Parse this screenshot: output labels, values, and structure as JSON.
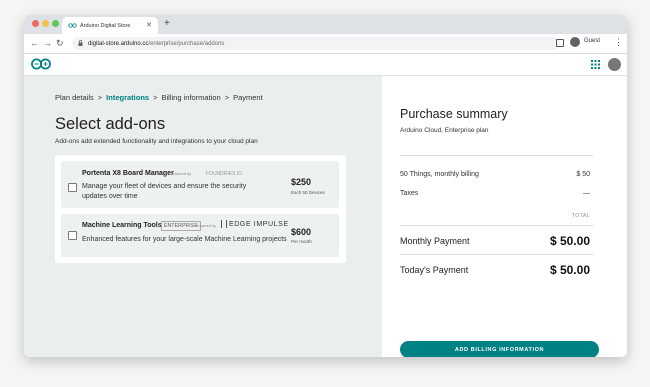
{
  "browser": {
    "tab_title": "Arduino Digital Store",
    "new_tab_label": "+",
    "url_host": "digital-store.arduino.cc",
    "url_path": "/enterprise/purchase/addons",
    "profile_label": "Guest",
    "dot_colors": [
      "#ed6a5e",
      "#f5bf4f",
      "#61c554"
    ]
  },
  "breadcrumb": {
    "items": [
      "Plan details",
      "Integrations",
      "Billing information",
      "Payment"
    ],
    "separator": ">"
  },
  "page": {
    "title": "Select add-ons",
    "subtitle": "Add-ons add extended functionality and integrations to your cloud plan"
  },
  "addons": [
    {
      "name": "Portenta X8 Board Manager",
      "powered_by": "Powered by",
      "brand": "FOUNDRIES.IO",
      "description": "Manage your fleet of devices and ensure the security updates over time",
      "price": "$250",
      "price_note": "Each 50 Devices"
    },
    {
      "name": "Machine Learning Tools",
      "badge": "ENTERPRISE",
      "powered_by": "Powered by",
      "brand": "EDGE IMPULSE",
      "description": "Enhanced features for your large-scale Machine Learning projects",
      "price": "$600",
      "price_note": "Per month"
    }
  ],
  "summary": {
    "title": "Purchase summary",
    "plan": "Arduino Cloud, Enterprise plan",
    "lines": [
      {
        "label": "50 Things, monthly billing",
        "value": "$ 50"
      },
      {
        "label": "Taxes",
        "value": "—"
      }
    ],
    "total_header": "TOTAL",
    "monthly_label": "Monthly Payment",
    "monthly_value": "$ 50.00",
    "today_label": "Today's Payment",
    "today_value": "$ 50.00",
    "cta_label": "ADD BILLING INFORMATION"
  },
  "colors": {
    "accent": "#008184",
    "left_panel_bg": "#eaeeee"
  }
}
